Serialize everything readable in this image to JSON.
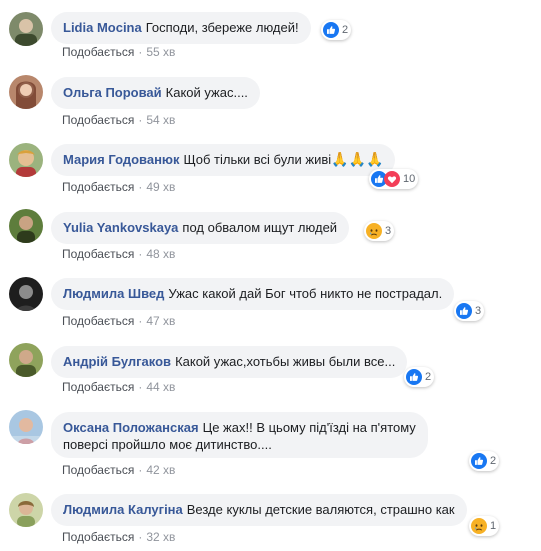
{
  "like_label": "Подобається",
  "icons": {
    "like": "thumbs-up-icon",
    "love": "heart-icon",
    "sad": "sad-face-icon",
    "prayer": "folded-hands-emoji"
  },
  "colors": {
    "name": "#385898",
    "bubble": "#f2f3f5",
    "like": "#1877f2",
    "love": "#f33e58",
    "sad": "#f7b125"
  },
  "comments": [
    {
      "author": "Lidia Mocina",
      "text": "Господи, збереже людей!",
      "time": "55 хв",
      "reaction_count": "2"
    },
    {
      "author": "Ольга Поровай",
      "text": "Какой ужас....",
      "time": "54 хв"
    },
    {
      "author": "Мария Годованюк",
      "text": "Щоб тільки всі були живі",
      "emoji": "🙏🙏🙏",
      "time": "49 хв",
      "reaction_count": "10"
    },
    {
      "author": "Yulia Yankovskaya",
      "text": "под обвалом ищут людей",
      "time": "48 хв",
      "reaction_count": "3"
    },
    {
      "author": "Людмила Швед",
      "text": "Ужас какой дай Бог чтоб никто не пострадал.",
      "time": "47 хв",
      "reaction_count": "3"
    },
    {
      "author": "Андрій Булгаков",
      "text": "Какой ужас,хотьбы живы были все...",
      "time": "44 хв",
      "reaction_count": "2"
    },
    {
      "author": "Оксана Положанская",
      "text_line1": "Це жах!! В цьому під'їзді на п'ятому",
      "text_line2": "поверсі пройшло моє дитинство....",
      "time": "42 хв",
      "reaction_count": "2"
    },
    {
      "author": "Людмила Калугіна",
      "text": "Везде куклы детские валяются, страшно как",
      "time": "32 хв",
      "reaction_count": "1"
    }
  ]
}
